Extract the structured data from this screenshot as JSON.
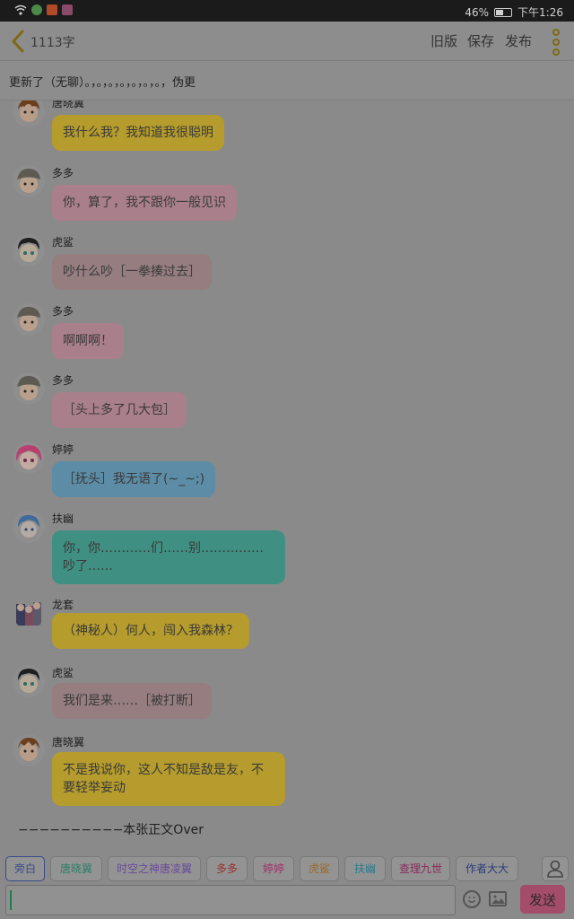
{
  "status_bar": {
    "battery": "46%",
    "battery_level": 0.46,
    "time": "下午1:26"
  },
  "header": {
    "word_count": "1113字",
    "old_version": "旧版",
    "save": "保存",
    "publish": "发布"
  },
  "chapter_title": "更新了（无聊）。，。，。，。，。，。，。，伪更",
  "messages": [
    {
      "name": "唐晓翼",
      "text": "我什么我？我知道我很聪明",
      "color": "#b59c2c",
      "avatar": "brown-hair-boy"
    },
    {
      "name": "多多",
      "text": "你，算了，我不跟你一般见识",
      "color": "#a97f8c",
      "avatar": "cap-boy"
    },
    {
      "name": "虎鲨",
      "text": "吵什么吵［一拳揍过去］",
      "color": "#957d80",
      "avatar": "black-hair-boy"
    },
    {
      "name": "多多",
      "text": "啊啊啊！",
      "color": "#a97f8c",
      "avatar": "cap-boy"
    },
    {
      "name": "多多",
      "text": "［头上多了几大包］",
      "color": "#a97f8c",
      "avatar": "cap-boy"
    },
    {
      "name": "婷婷",
      "text": "［抚头］我无语了(~_~;)",
      "color": "#5c8ca6",
      "avatar": "pink-hair-girl"
    },
    {
      "name": "扶幽",
      "text": "你，你…………们……别……………吵了……",
      "color": "#3f8f82",
      "avatar": "blue-hair-boy"
    },
    {
      "name": "龙套",
      "text": "（神秘人）何人，闯入我森林？",
      "color": "#b59c2c",
      "avatar": "group-avatar"
    },
    {
      "name": "虎鲨",
      "text": "我们是来……［被打断］",
      "color": "#957d80",
      "avatar": "black-hair-boy"
    },
    {
      "name": "唐晓翼",
      "text": "不是我说你，这人不知是敌是友，不要轻举妄动",
      "color": "#b59c2c",
      "avatar": "brown-hair-boy"
    }
  ],
  "closing_text": "−−−−−−−−−−本张正文Over",
  "role_tags": [
    {
      "label": "旁白",
      "color": "#3a4a8a"
    },
    {
      "label": "唐晓翼",
      "color": "#2f7f6a"
    },
    {
      "label": "时空之神唐凌翼",
      "color": "#6a4a9a"
    },
    {
      "label": "多多",
      "color": "#9a3030"
    },
    {
      "label": "婷婷",
      "color": "#a0306a"
    },
    {
      "label": "虎鲨",
      "color": "#9a6a2a"
    },
    {
      "label": "扶幽",
      "color": "#2a7a8a"
    },
    {
      "label": "查理九世",
      "color": "#8a2a5a"
    },
    {
      "label": "作者大大",
      "color": "#2a3a7a"
    }
  ],
  "input": {
    "value": "",
    "placeholder": ""
  },
  "send_label": "发送"
}
